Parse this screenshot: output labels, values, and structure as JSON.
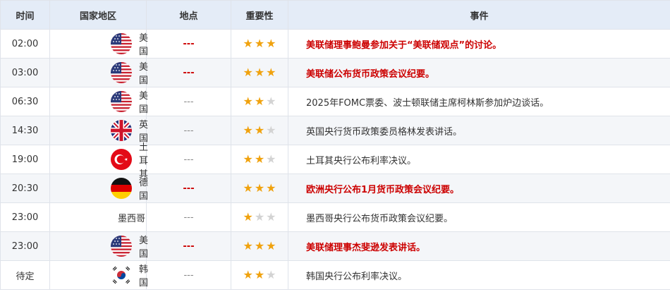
{
  "header": {
    "time": "时间",
    "country": "国家地区",
    "place": "地点",
    "importance": "重要性",
    "event": "事件"
  },
  "colors": {
    "high_importance_text": "#cc0000",
    "star_on": "#f0a20e",
    "star_off": "#d3d3d3",
    "header_bg": "#e4ecf7"
  },
  "rows": [
    {
      "time": "02:00",
      "country": "美国",
      "flag": "us-flag-icon",
      "place": "---",
      "stars": 3,
      "event": "美联储理事鲍曼参加关于“美联储观点”的讨论。",
      "high": true
    },
    {
      "time": "03:00",
      "country": "美国",
      "flag": "us-flag-icon",
      "place": "---",
      "stars": 3,
      "event": "美联储公布货币政策会议纪要。",
      "high": true
    },
    {
      "time": "06:30",
      "country": "美国",
      "flag": "us-flag-icon",
      "place": "---",
      "stars": 2,
      "event": "2025年FOMC票委、波士顿联储主席柯林斯参加炉边谈话。",
      "high": false
    },
    {
      "time": "14:30",
      "country": "英国",
      "flag": "uk-flag-icon",
      "place": "---",
      "stars": 2,
      "event": "英国央行货币政策委员格林发表讲话。",
      "high": false
    },
    {
      "time": "19:00",
      "country": "土耳其",
      "flag": "turkey-flag-icon",
      "place": "---",
      "stars": 2,
      "event": "土耳其央行公布利率决议。",
      "high": false
    },
    {
      "time": "20:30",
      "country": "德国",
      "flag": "germany-flag-icon",
      "place": "---",
      "stars": 3,
      "event": "欧洲央行公布1月货币政策会议纪要。",
      "high": true
    },
    {
      "time": "23:00",
      "country": "墨西哥",
      "flag": "",
      "place": "---",
      "stars": 1,
      "event": "墨西哥央行公布货币政策会议纪要。",
      "high": false
    },
    {
      "time": "23:00",
      "country": "美国",
      "flag": "us-flag-icon",
      "place": "---",
      "stars": 3,
      "event": "美联储理事杰斐逊发表讲话。",
      "high": true
    },
    {
      "time": "待定",
      "country": "韩国",
      "flag": "korea-flag-icon",
      "place": "---",
      "stars": 2,
      "event": "韩国央行公布利率决议。",
      "high": false
    }
  ]
}
